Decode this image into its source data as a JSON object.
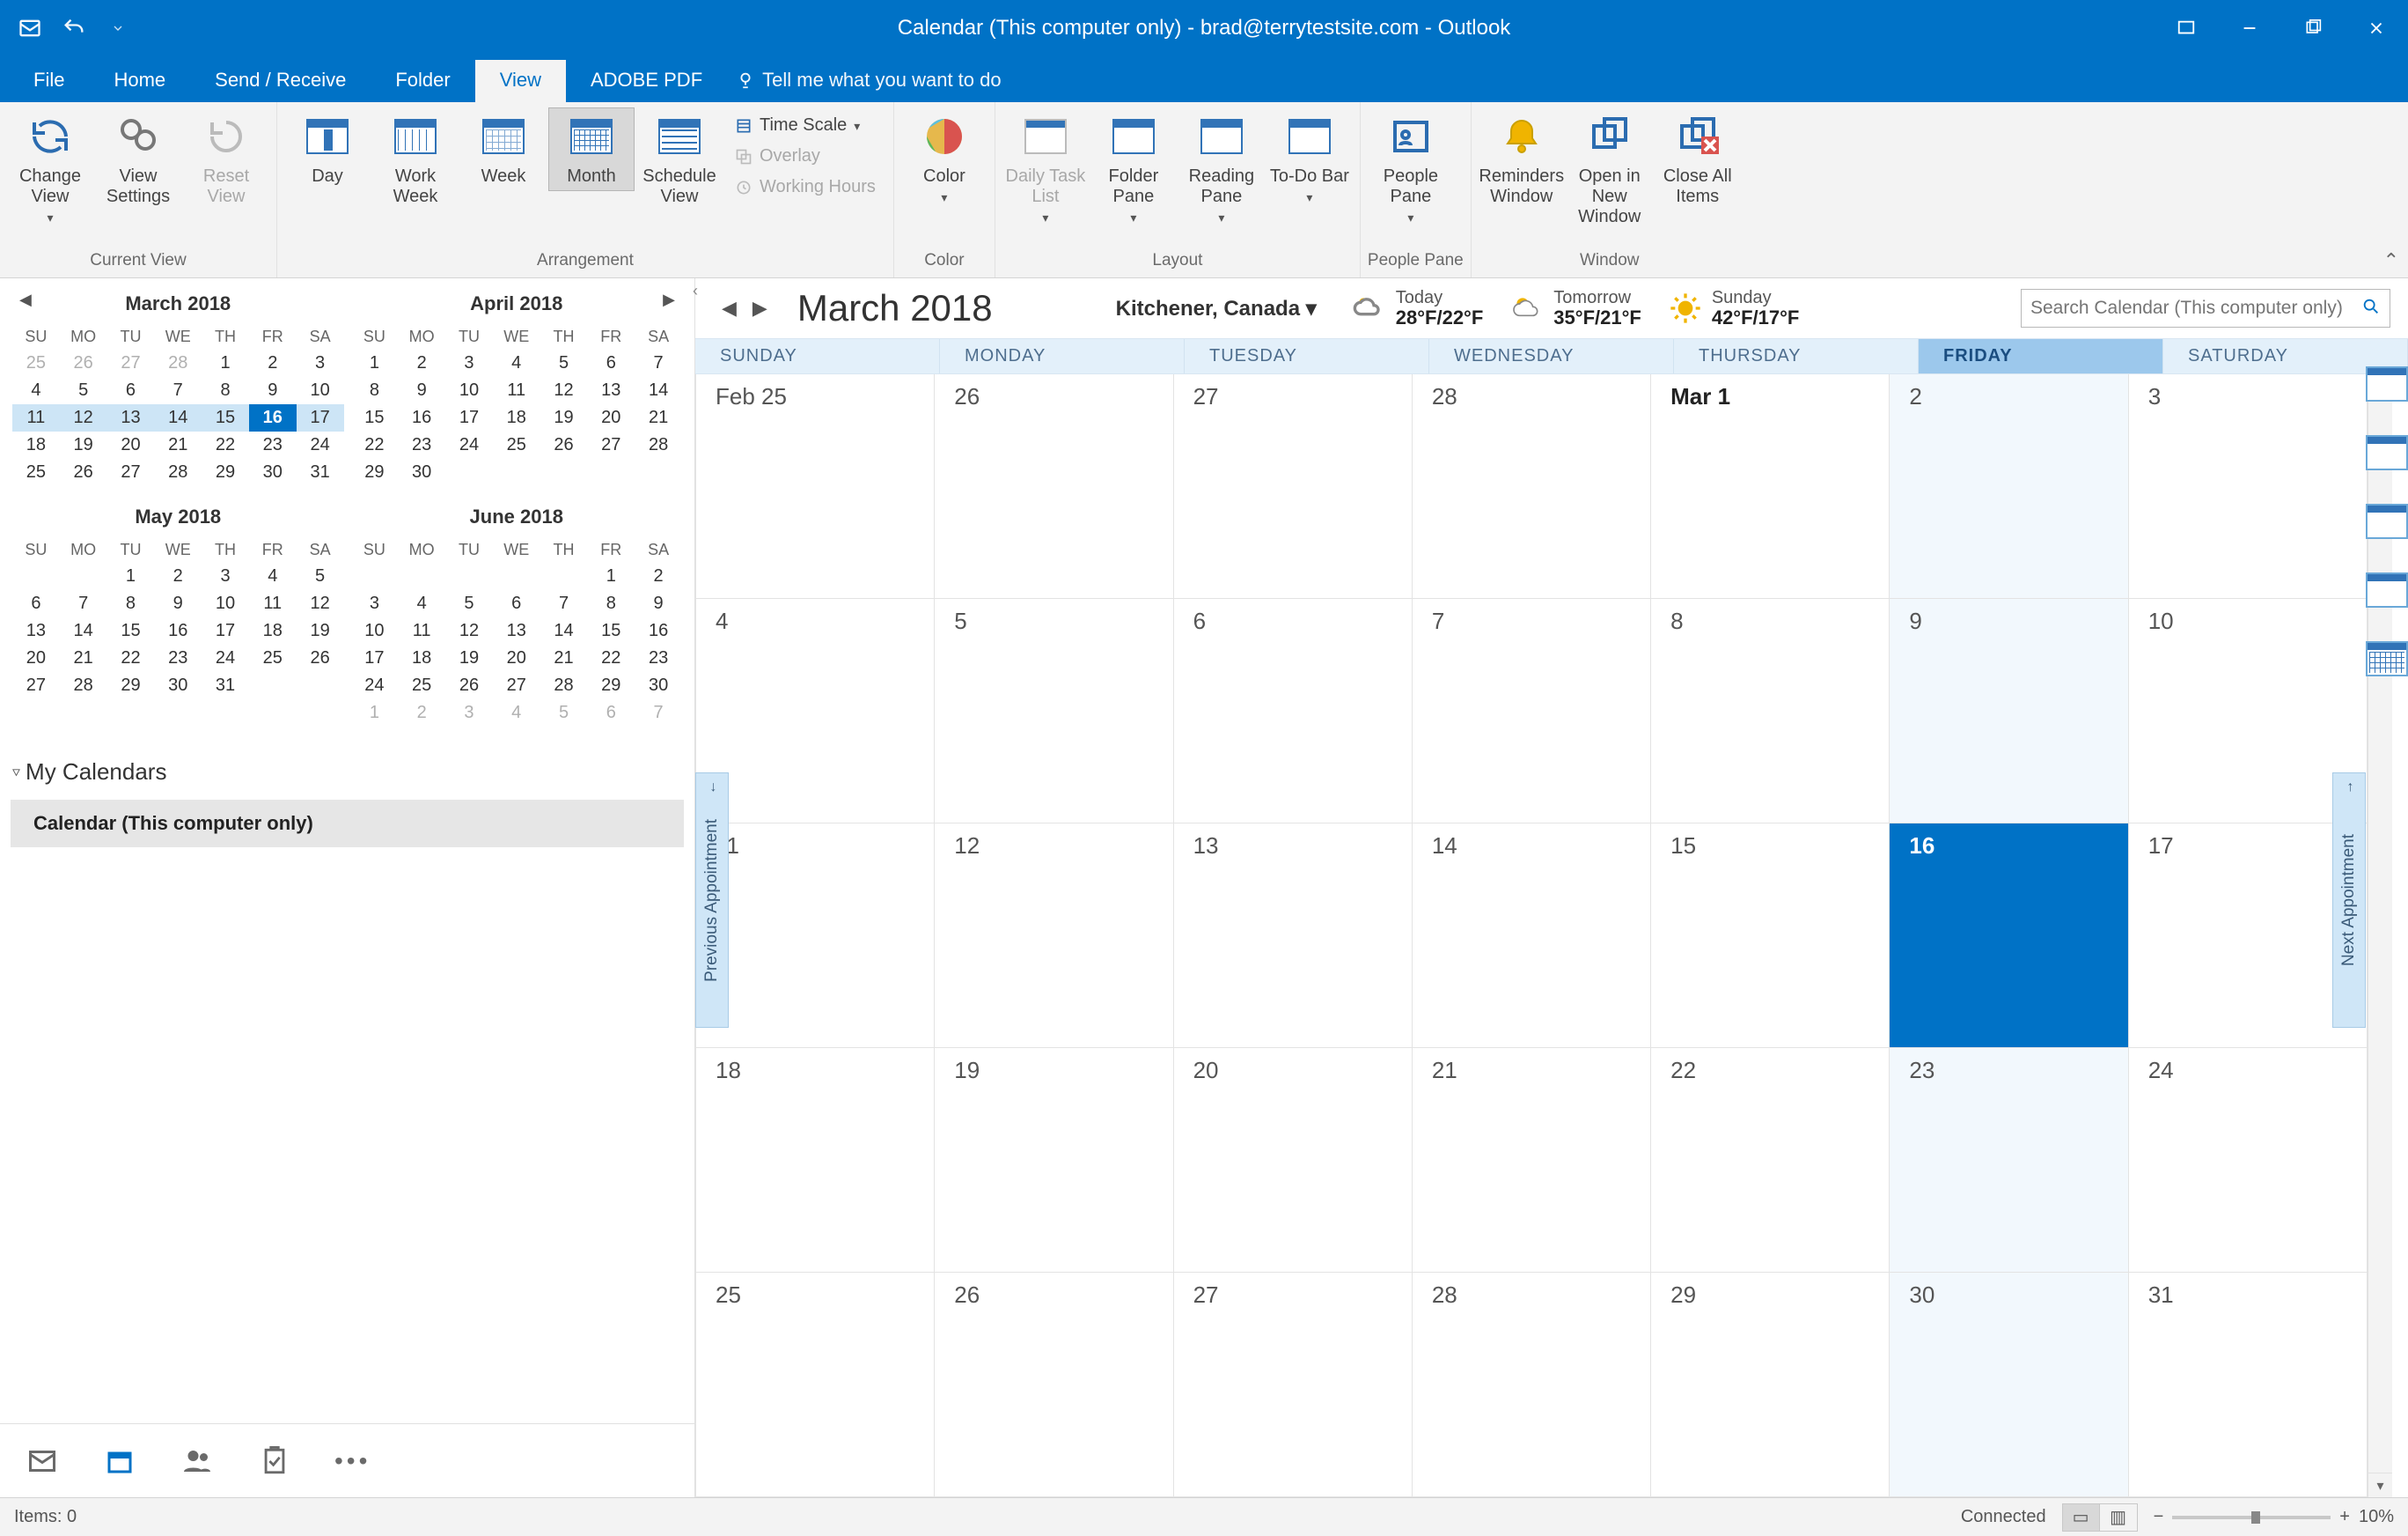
{
  "title": "Calendar (This computer only) - brad@terrytestsite.com  -  Outlook",
  "menu": {
    "file": "File",
    "home": "Home",
    "sendrecv": "Send / Receive",
    "folder": "Folder",
    "view": "View",
    "adobe": "ADOBE PDF",
    "tellme": "Tell me what you want to do"
  },
  "ribbon": {
    "currentview": {
      "change": "Change View",
      "settings": "View Settings",
      "reset": "Reset View",
      "label": "Current View"
    },
    "arrangement": {
      "day": "Day",
      "workweek": "Work Week",
      "week": "Week",
      "month": "Month",
      "schedule": "Schedule View",
      "timescale": "Time Scale",
      "overlay": "Overlay",
      "workinghours": "Working Hours",
      "label": "Arrangement"
    },
    "color": {
      "btn": "Color",
      "label": "Color"
    },
    "layout": {
      "daily": "Daily Task List",
      "folder": "Folder Pane",
      "reading": "Reading Pane",
      "todo": "To-Do Bar",
      "label": "Layout"
    },
    "people": {
      "btn": "People Pane",
      "label": "People Pane"
    },
    "window": {
      "reminders": "Reminders Window",
      "opennew": "Open in New Window",
      "closeall": "Close All Items",
      "label": "Window"
    }
  },
  "minicals": [
    {
      "title": "March 2018",
      "dow": [
        "SU",
        "MO",
        "TU",
        "WE",
        "TH",
        "FR",
        "SA"
      ],
      "rows": [
        [
          "25",
          "26",
          "27",
          "28",
          "1",
          "2",
          "3"
        ],
        [
          "4",
          "5",
          "6",
          "7",
          "8",
          "9",
          "10"
        ],
        [
          "11",
          "12",
          "13",
          "14",
          "15",
          "16",
          "17"
        ],
        [
          "18",
          "19",
          "20",
          "21",
          "22",
          "23",
          "24"
        ],
        [
          "25",
          "26",
          "27",
          "28",
          "29",
          "30",
          "31"
        ]
      ],
      "dimCells": [
        [
          0,
          0
        ],
        [
          0,
          1
        ],
        [
          0,
          2
        ],
        [
          0,
          3
        ]
      ],
      "hlRow": 2,
      "today": [
        2,
        5
      ]
    },
    {
      "title": "April 2018",
      "dow": [
        "SU",
        "MO",
        "TU",
        "WE",
        "TH",
        "FR",
        "SA"
      ],
      "rows": [
        [
          "1",
          "2",
          "3",
          "4",
          "5",
          "6",
          "7"
        ],
        [
          "8",
          "9",
          "10",
          "11",
          "12",
          "13",
          "14"
        ],
        [
          "15",
          "16",
          "17",
          "18",
          "19",
          "20",
          "21"
        ],
        [
          "22",
          "23",
          "24",
          "25",
          "26",
          "27",
          "28"
        ],
        [
          "29",
          "30",
          "",
          "",
          "",
          "",
          ""
        ]
      ]
    },
    {
      "title": "May 2018",
      "dow": [
        "SU",
        "MO",
        "TU",
        "WE",
        "TH",
        "FR",
        "SA"
      ],
      "rows": [
        [
          "",
          "",
          "1",
          "2",
          "3",
          "4",
          "5"
        ],
        [
          "6",
          "7",
          "8",
          "9",
          "10",
          "11",
          "12"
        ],
        [
          "13",
          "14",
          "15",
          "16",
          "17",
          "18",
          "19"
        ],
        [
          "20",
          "21",
          "22",
          "23",
          "24",
          "25",
          "26"
        ],
        [
          "27",
          "28",
          "29",
          "30",
          "31",
          "",
          ""
        ]
      ]
    },
    {
      "title": "June 2018",
      "dow": [
        "SU",
        "MO",
        "TU",
        "WE",
        "TH",
        "FR",
        "SA"
      ],
      "rows": [
        [
          "",
          "",
          "",
          "",
          "",
          "1",
          "2"
        ],
        [
          "3",
          "4",
          "5",
          "6",
          "7",
          "8",
          "9"
        ],
        [
          "10",
          "11",
          "12",
          "13",
          "14",
          "15",
          "16"
        ],
        [
          "17",
          "18",
          "19",
          "20",
          "21",
          "22",
          "23"
        ],
        [
          "24",
          "25",
          "26",
          "27",
          "28",
          "29",
          "30"
        ],
        [
          "1",
          "2",
          "3",
          "4",
          "5",
          "6",
          "7"
        ]
      ],
      "dimCells": [
        [
          5,
          0
        ],
        [
          5,
          1
        ],
        [
          5,
          2
        ],
        [
          5,
          3
        ],
        [
          5,
          4
        ],
        [
          5,
          5
        ],
        [
          5,
          6
        ]
      ]
    }
  ],
  "nav": {
    "mycals": "My Calendars",
    "calitem": "Calendar (This computer only)"
  },
  "calheader": {
    "month": "March 2018",
    "location": "Kitchener, Canada"
  },
  "weather": [
    {
      "label": "Today",
      "temp": "28°F/22°F",
      "icon": "cloud"
    },
    {
      "label": "Tomorrow",
      "temp": "35°F/21°F",
      "icon": "partly"
    },
    {
      "label": "Sunday",
      "temp": "42°F/17°F",
      "icon": "sun"
    }
  ],
  "search": {
    "placeholder": "Search Calendar (This computer only)"
  },
  "daynames": [
    "SUNDAY",
    "MONDAY",
    "TUESDAY",
    "WEDNESDAY",
    "THURSDAY",
    "FRIDAY",
    "SATURDAY"
  ],
  "todayCol": 5,
  "monthcells": [
    [
      "Feb 25",
      "26",
      "27",
      "28",
      "Mar 1",
      "2",
      "3"
    ],
    [
      "4",
      "5",
      "6",
      "7",
      "8",
      "9",
      "10"
    ],
    [
      "11",
      "12",
      "13",
      "14",
      "15",
      "16",
      "17"
    ],
    [
      "18",
      "19",
      "20",
      "21",
      "22",
      "23",
      "24"
    ],
    [
      "25",
      "26",
      "27",
      "28",
      "29",
      "30",
      "31"
    ]
  ],
  "boldCells": [
    [
      0,
      4
    ]
  ],
  "selectedCell": [
    2,
    5
  ],
  "appt": {
    "prev": "Previous Appointment",
    "next": "Next Appointment"
  },
  "status": {
    "items": "Items: 0",
    "connected": "Connected",
    "zoom": "10%"
  }
}
